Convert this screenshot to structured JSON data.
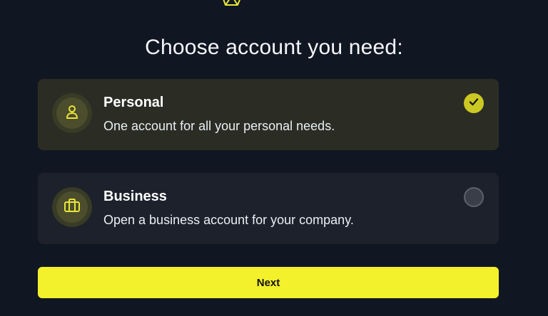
{
  "header": {
    "logo_icon": "gem-logo-icon",
    "title": "Choose account you need:"
  },
  "options": [
    {
      "icon": "user-icon",
      "title": "Personal",
      "description": "One account for all your personal needs.",
      "selected": true
    },
    {
      "icon": "briefcase-icon",
      "title": "Business",
      "description": "Open a business account for your company.",
      "selected": false
    }
  ],
  "actions": {
    "next_label": "Next"
  },
  "colors": {
    "background": "#111722",
    "accent": "#f3f02c",
    "check": "#ccc823",
    "selected_card": "#2b2d24",
    "card": "#1c212b"
  }
}
